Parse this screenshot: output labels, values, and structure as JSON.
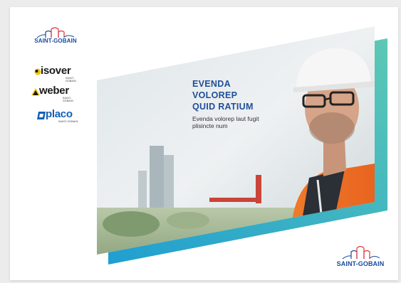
{
  "brand": {
    "parent_logo_text": "SAINT-GOBAIN",
    "sub_brands": [
      {
        "name": "isover",
        "tagline": "SAINT-GOBAIN",
        "icon": "isover-logo-icon"
      },
      {
        "name": "weber",
        "tagline": "SAINT-GOBAIN",
        "icon": "weber-logo-icon"
      },
      {
        "name": "placo",
        "tagline": "SAINT-GOBAIN",
        "icon": "placo-logo-icon"
      }
    ]
  },
  "hero": {
    "title_lines": [
      "EVENDA",
      "VOLOREP",
      "QUID RATIUM"
    ],
    "subtitle": "Evenda volorep laut fugit plisincte num",
    "image": "construction-worker-photo"
  },
  "footer": {
    "logo_text": "SAINT-GOBAIN"
  },
  "colors": {
    "brand_blue": "#1f4f99",
    "sg_red": "#e2343b",
    "teal_gradient_start": "#2aa8b4",
    "teal_gradient_end": "#4fc3b7",
    "isover_yellow": "#f2c400",
    "placo_blue": "#1560b5"
  }
}
